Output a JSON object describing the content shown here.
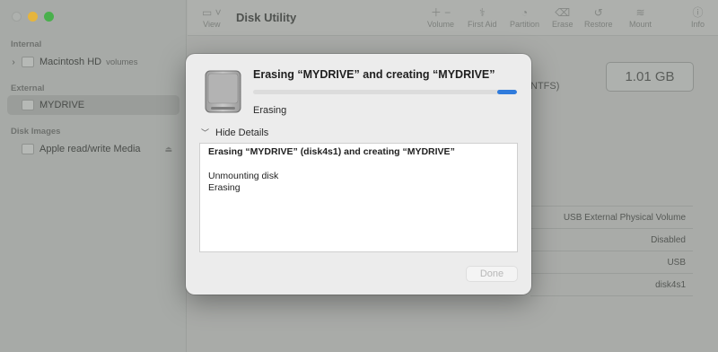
{
  "app": {
    "title": "Disk Utility"
  },
  "toolbar": {
    "view_label": "View",
    "volume_label": "Volume",
    "first_aid_label": "First Aid",
    "partition_label": "Partition",
    "erase_label": "Erase",
    "restore_label": "Restore",
    "mount_label": "Mount",
    "info_label": "Info"
  },
  "sidebar": {
    "sections": [
      {
        "title": "Internal",
        "items": [
          {
            "label": "Macintosh HD",
            "sub": "volumes"
          }
        ]
      },
      {
        "title": "External",
        "items": [
          {
            "label": "MYDRIVE"
          }
        ]
      },
      {
        "title": "Disk Images",
        "items": [
          {
            "label": "Apple read/write Media"
          }
        ]
      }
    ]
  },
  "main": {
    "capacity": "1.01 GB",
    "format_fragment": "NTFS)",
    "info_rows": [
      "USB External Physical Volume",
      "Disabled",
      "USB",
      "disk4s1"
    ]
  },
  "dialog": {
    "title": "Erasing “MYDRIVE” and creating “MYDRIVE”",
    "status": "Erasing",
    "hide_details_label": "Hide Details",
    "log": {
      "line1": "Erasing “MYDRIVE” (disk4s1) and creating “MYDRIVE”",
      "line2": "Unmounting disk",
      "line3": "Erasing"
    },
    "done_label": "Done",
    "progress_color": "#2f7bdc"
  }
}
